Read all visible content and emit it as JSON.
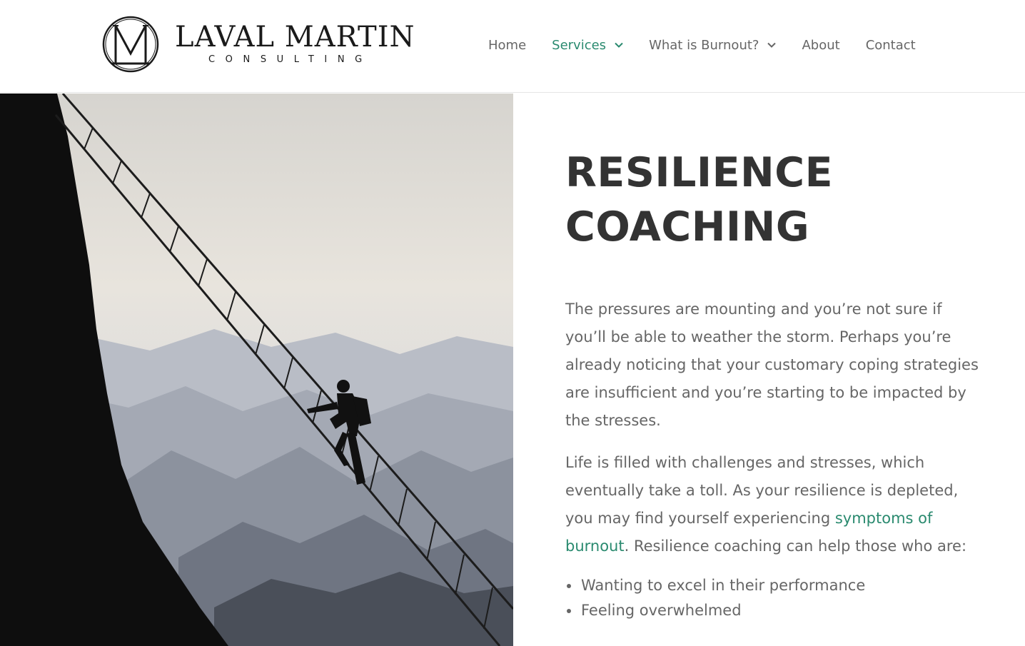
{
  "brand": {
    "name": "LAVAL MARTIN",
    "tagline": "CONSULTING",
    "monogram": "M"
  },
  "nav": {
    "items": [
      {
        "label": "Home",
        "active": false,
        "dropdown": false
      },
      {
        "label": "Services",
        "active": true,
        "dropdown": true
      },
      {
        "label": "What is Burnout?",
        "active": false,
        "dropdown": true
      },
      {
        "label": "About",
        "active": false,
        "dropdown": false
      },
      {
        "label": "Contact",
        "active": false,
        "dropdown": false
      }
    ]
  },
  "page": {
    "title_line1": "RESILIENCE",
    "title_line2": "COACHING",
    "paragraph1": "The pressures are mounting and you’re not sure if you’ll be able to weather the storm. Perhaps you’re already noticing that your customary coping strategies are insufficient and you’re starting to be impacted by the stresses.",
    "paragraph2_before": "Life is filled with challenges and stresses, which eventually take a toll. As your resilience is depleted, you may find yourself experiencing ",
    "paragraph2_link": "symptoms of burnout",
    "paragraph2_after": ". Resilience coaching can help those who are:",
    "list": [
      "Wanting to excel in their performance",
      "Feeling overwhelmed"
    ]
  },
  "colors": {
    "accent": "#2a8a6f",
    "heading": "#333333",
    "body_text": "#666666"
  },
  "icons": {
    "dropdown": "chevron-down-icon",
    "bullet": "bullet-icon"
  }
}
